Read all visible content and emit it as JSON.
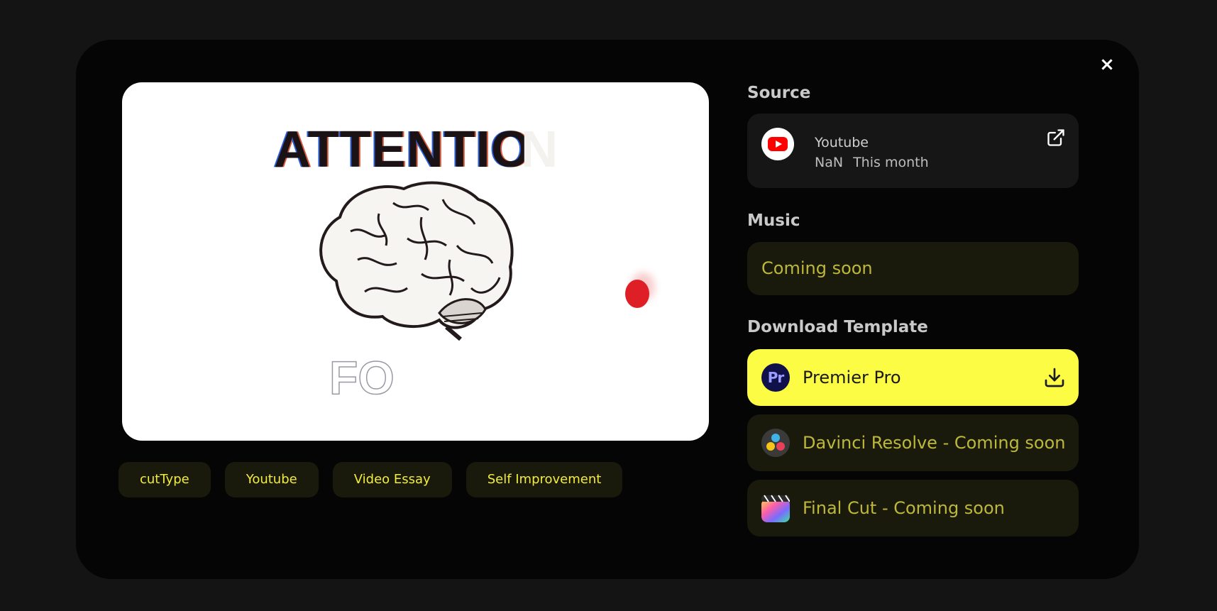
{
  "close": {
    "label": "×"
  },
  "preview": {
    "headline": "ATTENTIO",
    "headline_ghost": "N",
    "subtext": "FO"
  },
  "tags": [
    "cutType",
    "Youtube",
    "Video Essay",
    "Self Improvement"
  ],
  "source": {
    "title": "Source",
    "platform": "Youtube",
    "views": "NaN",
    "date": "This month",
    "icon": "youtube-icon",
    "link_icon": "external-link-icon"
  },
  "music": {
    "title": "Music",
    "status": "Coming soon"
  },
  "download": {
    "title": "Download Template",
    "items": [
      {
        "label": "Premier Pro",
        "icon": "premiere-pro-icon",
        "active": true
      },
      {
        "label": "Davinci Resolve - Coming soon",
        "icon": "davinci-resolve-icon",
        "active": false
      },
      {
        "label": "Final Cut - Coming soon",
        "icon": "final-cut-icon",
        "active": false
      }
    ]
  },
  "colors": {
    "accent": "#fcfc44",
    "tag_text": "#f2ec3c",
    "muted_accent": "#bdb83a",
    "modal_bg": "#050505",
    "page_bg": "#141414"
  }
}
